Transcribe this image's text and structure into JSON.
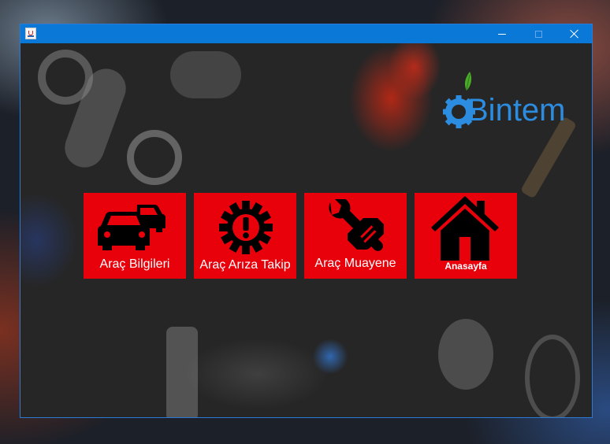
{
  "window": {
    "title": "",
    "controls": {
      "minimize": "minimize-icon",
      "maximize": "maximize-icon",
      "close": "close-icon"
    }
  },
  "logo": {
    "text": "Bintem",
    "icon": "gear-leaf-icon",
    "color": "#2c8ce0"
  },
  "tiles": [
    {
      "label": "Araç Bilgileri",
      "icon": "cars-icon"
    },
    {
      "label": "Araç Arıza Takip",
      "icon": "gear-alert-icon"
    },
    {
      "label": "Araç Muayene",
      "icon": "wrench-hand-icon"
    },
    {
      "label": "Anasayfa",
      "icon": "home-icon"
    }
  ],
  "colors": {
    "tile_bg": "#e8000b",
    "titlebar": "#0a78d7",
    "content_bg": "#262626"
  }
}
